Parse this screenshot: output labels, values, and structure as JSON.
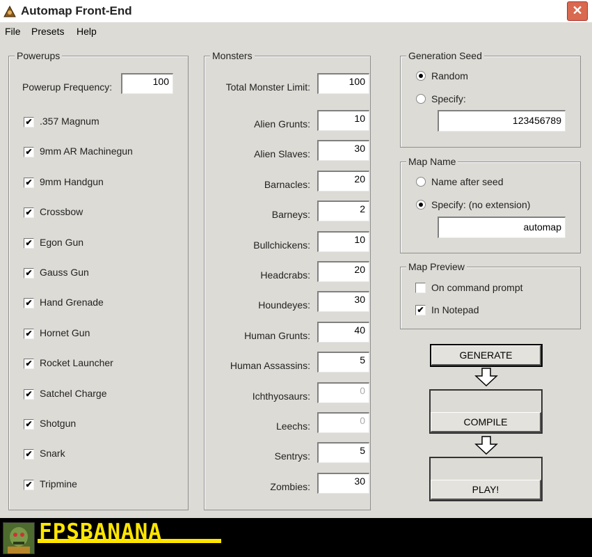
{
  "window": {
    "title": "Automap Front-End",
    "close_label": "✕"
  },
  "menu": [
    "File",
    "Presets",
    "Help"
  ],
  "powerups": {
    "title": "Powerups",
    "frequency_label": "Powerup Frequency:",
    "frequency_value": "100",
    "items": [
      {
        "label": ".357 Magnum",
        "checked": true
      },
      {
        "label": "9mm AR Machinegun",
        "checked": true
      },
      {
        "label": "9mm Handgun",
        "checked": true
      },
      {
        "label": "Crossbow",
        "checked": true
      },
      {
        "label": "Egon Gun",
        "checked": true
      },
      {
        "label": "Gauss Gun",
        "checked": true
      },
      {
        "label": "Hand Grenade",
        "checked": true
      },
      {
        "label": "Hornet Gun",
        "checked": true
      },
      {
        "label": "Rocket Launcher",
        "checked": true
      },
      {
        "label": "Satchel Charge",
        "checked": true
      },
      {
        "label": "Shotgun",
        "checked": true
      },
      {
        "label": "Snark",
        "checked": true
      },
      {
        "label": "Tripmine",
        "checked": true
      }
    ]
  },
  "monsters": {
    "title": "Monsters",
    "total_label": "Total Monster Limit:",
    "total_value": "100",
    "items": [
      {
        "label": "Alien Grunts:",
        "value": "10",
        "enabled": true
      },
      {
        "label": "Alien Slaves:",
        "value": "30",
        "enabled": true
      },
      {
        "label": "Barnacles:",
        "value": "20",
        "enabled": true
      },
      {
        "label": "Barneys:",
        "value": "2",
        "enabled": true
      },
      {
        "label": "Bullchickens:",
        "value": "10",
        "enabled": true
      },
      {
        "label": "Headcrabs:",
        "value": "20",
        "enabled": true
      },
      {
        "label": "Houndeyes:",
        "value": "30",
        "enabled": true
      },
      {
        "label": "Human Grunts:",
        "value": "40",
        "enabled": true
      },
      {
        "label": "Human Assassins:",
        "value": "5",
        "enabled": true
      },
      {
        "label": "Ichthyosaurs:",
        "value": "0",
        "enabled": false
      },
      {
        "label": "Leechs:",
        "value": "0",
        "enabled": false
      },
      {
        "label": "Sentrys:",
        "value": "5",
        "enabled": true
      },
      {
        "label": "Zombies:",
        "value": "30",
        "enabled": true
      }
    ]
  },
  "seed": {
    "title": "Generation Seed",
    "random_label": "Random",
    "specify_label": "Specify:",
    "selected": "random",
    "value": "123456789"
  },
  "map_name": {
    "title": "Map Name",
    "after_seed_label": "Name after seed",
    "specify_label": "Specify: (no extension)",
    "selected": "specify",
    "value": "automap"
  },
  "preview": {
    "title": "Map Preview",
    "command_prompt_label": "On command prompt",
    "command_prompt_checked": false,
    "notepad_label": "In Notepad",
    "notepad_checked": true
  },
  "actions": {
    "generate": "GENERATE",
    "compile": "COMPILE",
    "play": "PLAY!"
  },
  "banner": {
    "text": "FPSBANANA"
  }
}
